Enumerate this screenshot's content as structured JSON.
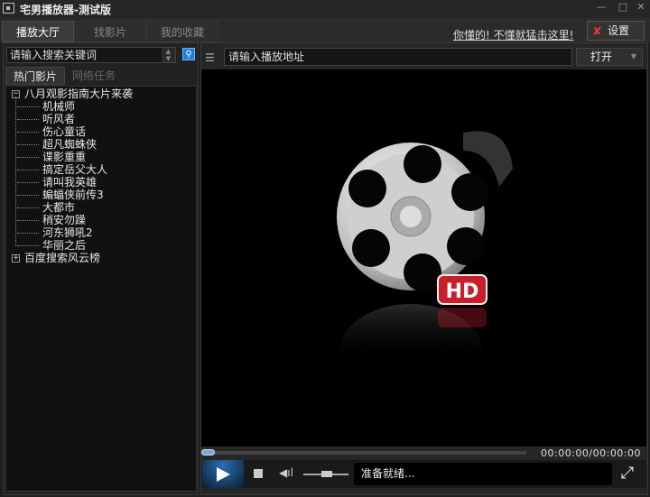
{
  "window": {
    "title": "宅男播放器-测试版",
    "minimize": "—",
    "maximize": "□",
    "close": "✕"
  },
  "tabs": [
    {
      "label": "播放大厅",
      "active": true
    },
    {
      "label": "找影片"
    },
    {
      "label": "我的收藏"
    }
  ],
  "help_link": "你懂的! 不懂就猛击这里!",
  "settings_label": "设置",
  "search": {
    "placeholder": "请输入搜索关键词"
  },
  "subtabs": [
    {
      "label": "热门影片",
      "active": true
    },
    {
      "label": "网络任务"
    }
  ],
  "tree": {
    "root1": {
      "label": "八月观影指南大片来袭",
      "expanded": true,
      "children": [
        "机械师",
        "听风者",
        "伤心童话",
        "超凡蜘蛛侠",
        "谍影重重",
        "搞定岳父大人",
        "请叫我英雄",
        "蝙蝠侠前传3",
        "大都市",
        "稍安勿躁",
        "河东狮吼2",
        "华丽之后"
      ]
    },
    "root2": {
      "label": "百度搜索风云榜",
      "expanded": false
    }
  },
  "url": {
    "placeholder": "请输入播放地址"
  },
  "open_label": "打开",
  "player": {
    "badge": "HD",
    "time": "00:00:00/00:00:00",
    "status": "准备就绪...",
    "progress": 0,
    "volume": 0.6
  },
  "colors": {
    "accent": "#1e7fd8",
    "badge": "#c8202a"
  }
}
